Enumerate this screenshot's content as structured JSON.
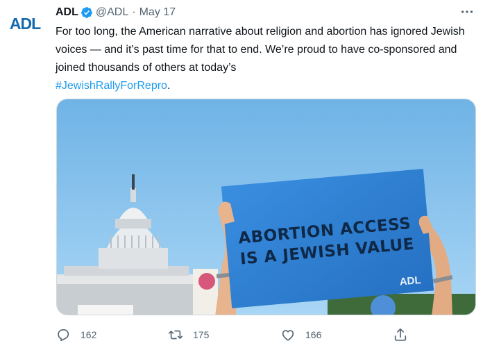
{
  "tweet": {
    "avatar_text": "ADL",
    "author_name": "ADL",
    "handle": "@ADL",
    "separator": "·",
    "date": "May 17",
    "text_main": "For too long, the American narrative about religion and abortion has ignored Jewish voices — and it’s past time for that to end. We’re proud to have co-sponsored and joined thousands of others at today’s",
    "hashtag": "#JewishRallyForRepro",
    "text_end": "."
  },
  "image": {
    "sign_line1": "ABORTION ACCESS",
    "sign_line2": "IS A JEWISH VALUE",
    "sign_logo": "ADL"
  },
  "actions": {
    "replies": "162",
    "retweets": "175",
    "likes": "166"
  },
  "colors": {
    "accent": "#1d9bf0",
    "secondary_text": "#536471",
    "brand": "#1569ad",
    "sign_blue": "#2f7fd1"
  },
  "icons": [
    "verified-badge-icon",
    "more-icon",
    "reply-icon",
    "retweet-icon",
    "like-icon",
    "share-icon"
  ]
}
